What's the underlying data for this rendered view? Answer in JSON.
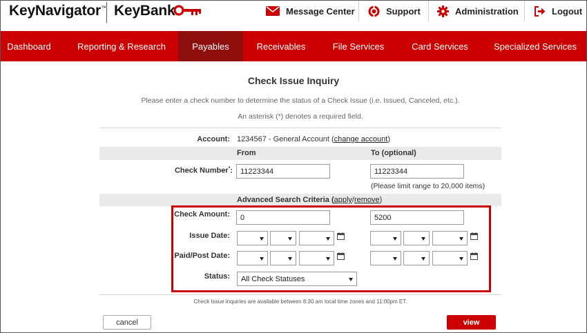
{
  "header": {
    "brand_keynavigator": "KeyNavigator",
    "brand_tm": "™",
    "brand_keybank": "KeyBank",
    "links": {
      "message_center": "Message Center",
      "support": "Support",
      "administration": "Administration",
      "logout": "Logout"
    }
  },
  "nav": {
    "items": [
      "Dashboard",
      "Reporting & Research",
      "Payables",
      "Receivables",
      "File Services",
      "Card Services",
      "Specialized Services"
    ],
    "active": "Payables"
  },
  "page": {
    "title": "Check Issue Inquiry",
    "description": "Please enter a check number to determine the status of a Check Issue (i.e. Issued, Canceled, etc.).",
    "asterisk_note": "An asterisk (*) denotes a required field."
  },
  "form": {
    "account_label": "Account:",
    "account_value": "1234567 - General Account (",
    "change_account_link": "change account",
    "account_close": ")",
    "from_header": "From",
    "to_header": "To (optional)",
    "check_number_label": "Check Number",
    "required_mark": "*",
    "label_colon": ":",
    "check_number_from": "11223344",
    "check_number_to": "11223344",
    "range_hint": "(Please limit range to 20,000 items)",
    "advanced_label": "Advanced Search Criteria (",
    "apply_link": "apply",
    "slash": "/",
    "remove_link": "remove",
    "advanced_close": ")",
    "check_amount_label": "Check Amount:",
    "check_amount_from": "0",
    "check_amount_to": "5200",
    "issue_date_label": "Issue Date:",
    "paid_post_date_label": "Paid/Post Date:",
    "status_label": "Status:",
    "status_value": "All Check Statuses"
  },
  "footer": {
    "availability_note": "Check Issue inquiries are available between 8:30 am local time zones and 11:00pm ET.",
    "cancel_label": "cancel",
    "view_label": "view"
  },
  "colors": {
    "brand_red": "#cc0000",
    "active_nav": "#8f0e0e"
  },
  "icons": [
    "key-icon",
    "envelope-icon",
    "lifebuoy-icon",
    "gear-icon",
    "logout-icon",
    "calendar-icon",
    "chevron-down-icon"
  ]
}
